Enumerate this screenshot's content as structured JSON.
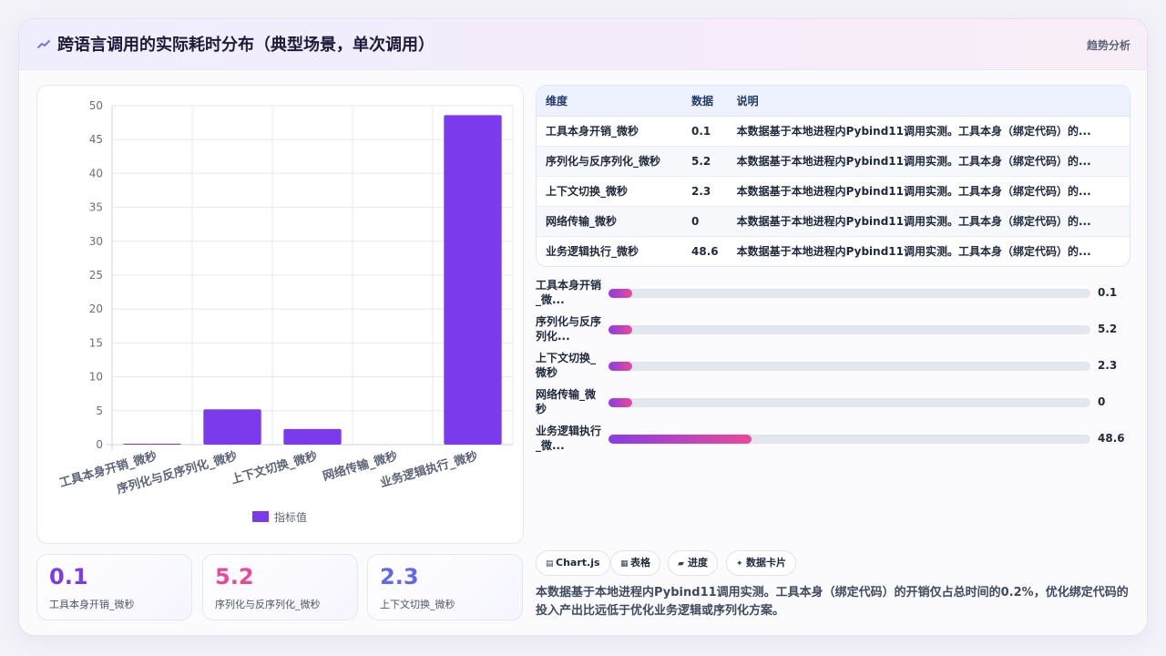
{
  "header": {
    "title": "跨语言调用的实际耗时分布（典型场景，单次调用）",
    "tag": "趋势分析"
  },
  "chart_data": {
    "type": "bar",
    "categories": [
      "工具本身开销_微秒",
      "序列化与反序列化_微秒",
      "上下文切换_微秒",
      "网络传输_微秒",
      "业务逻辑执行_微秒"
    ],
    "series": [
      {
        "name": "指标值",
        "values": [
          0.1,
          5.2,
          2.3,
          0,
          48.6
        ]
      }
    ],
    "ylim": [
      0,
      50
    ],
    "yticks": [
      0,
      5,
      10,
      15,
      20,
      25,
      30,
      35,
      40,
      45,
      50
    ],
    "legend": "bottom",
    "grid": true,
    "color": "#7c3aed"
  },
  "kpis": [
    {
      "value": "0.1",
      "label": "工具本身开销_微秒",
      "color": "#7c3aed"
    },
    {
      "value": "5.2",
      "label": "序列化与反序列化_微秒",
      "color": "#ec4899"
    },
    {
      "value": "2.3",
      "label": "上下文切换_微秒",
      "color": "#6366f1"
    }
  ],
  "table": {
    "headers": [
      "维度",
      "数据",
      "说明"
    ],
    "rows": [
      [
        "工具本身开销_微秒",
        "0.1",
        "本数据基于本地进程内Pybind11调用实测。工具本身（绑定代码）的..."
      ],
      [
        "序列化与反序列化_微秒",
        "5.2",
        "本数据基于本地进程内Pybind11调用实测。工具本身（绑定代码）的..."
      ],
      [
        "上下文切换_微秒",
        "2.3",
        "本数据基于本地进程内Pybind11调用实测。工具本身（绑定代码）的..."
      ],
      [
        "网络传输_微秒",
        "0",
        "本数据基于本地进程内Pybind11调用实测。工具本身（绑定代码）的..."
      ],
      [
        "业务逻辑执行_微秒",
        "48.6",
        "本数据基于本地进程内Pybind11调用实测。工具本身（绑定代码）的..."
      ]
    ]
  },
  "progress": {
    "max": 48.6,
    "items": [
      {
        "label_line1": "工具本身开销",
        "label_line2": "_微...",
        "value": 0.1,
        "display": "0.1"
      },
      {
        "label_line1": "序列化与反序",
        "label_line2": "列化...",
        "value": 5.2,
        "display": "5.2"
      },
      {
        "label_line1": "上下文切换_",
        "label_line2": "微秒",
        "value": 2.3,
        "display": "2.3"
      },
      {
        "label_line1": "网络传输_微",
        "label_line2": "秒",
        "value": 0,
        "display": "0"
      },
      {
        "label_line1": "业务逻辑执行",
        "label_line2": "_微...",
        "value": 48.6,
        "display": "48.6"
      }
    ]
  },
  "chips": [
    {
      "icon": "▤",
      "label": "Chart.js",
      "icon_name": "chart-icon"
    },
    {
      "icon": "▦",
      "label": "表格",
      "icon_name": "table-icon"
    },
    {
      "icon": "▰",
      "label": "进度",
      "icon_name": "progress-icon"
    },
    {
      "icon": "✦",
      "label": "数据卡片",
      "icon_name": "sparkle-icon"
    }
  ],
  "note": "本数据基于本地进程内Pybind11调用实测。工具本身（绑定代码）的开销仅占总时间的0.2%，优化绑定代码的投入产出比远低于优化业务逻辑或序列化方案。"
}
